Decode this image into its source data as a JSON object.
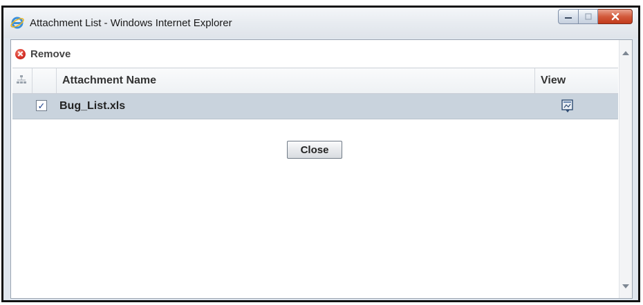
{
  "window": {
    "title": "Attachment List - Windows Internet Explorer",
    "icon": "ie-logo-icon"
  },
  "toolbar": {
    "remove_label": "Remove",
    "remove_icon": "remove-icon"
  },
  "grid": {
    "columns": [
      {
        "key": "tree",
        "label": "",
        "icon": "tree-icon"
      },
      {
        "key": "select",
        "label": ""
      },
      {
        "key": "name",
        "label": "Attachment Name"
      },
      {
        "key": "view",
        "label": "View"
      }
    ],
    "rows": [
      {
        "checked": true,
        "check_glyph": "✓",
        "name": "Bug_List.xls",
        "view_icon": "view-document-icon",
        "selected": true
      }
    ]
  },
  "buttons": {
    "close_label": "Close"
  },
  "colors": {
    "selected_row": "#c9d3dd",
    "titlebar": "#e7ebf0",
    "close_window_button": "#c13a1b"
  }
}
